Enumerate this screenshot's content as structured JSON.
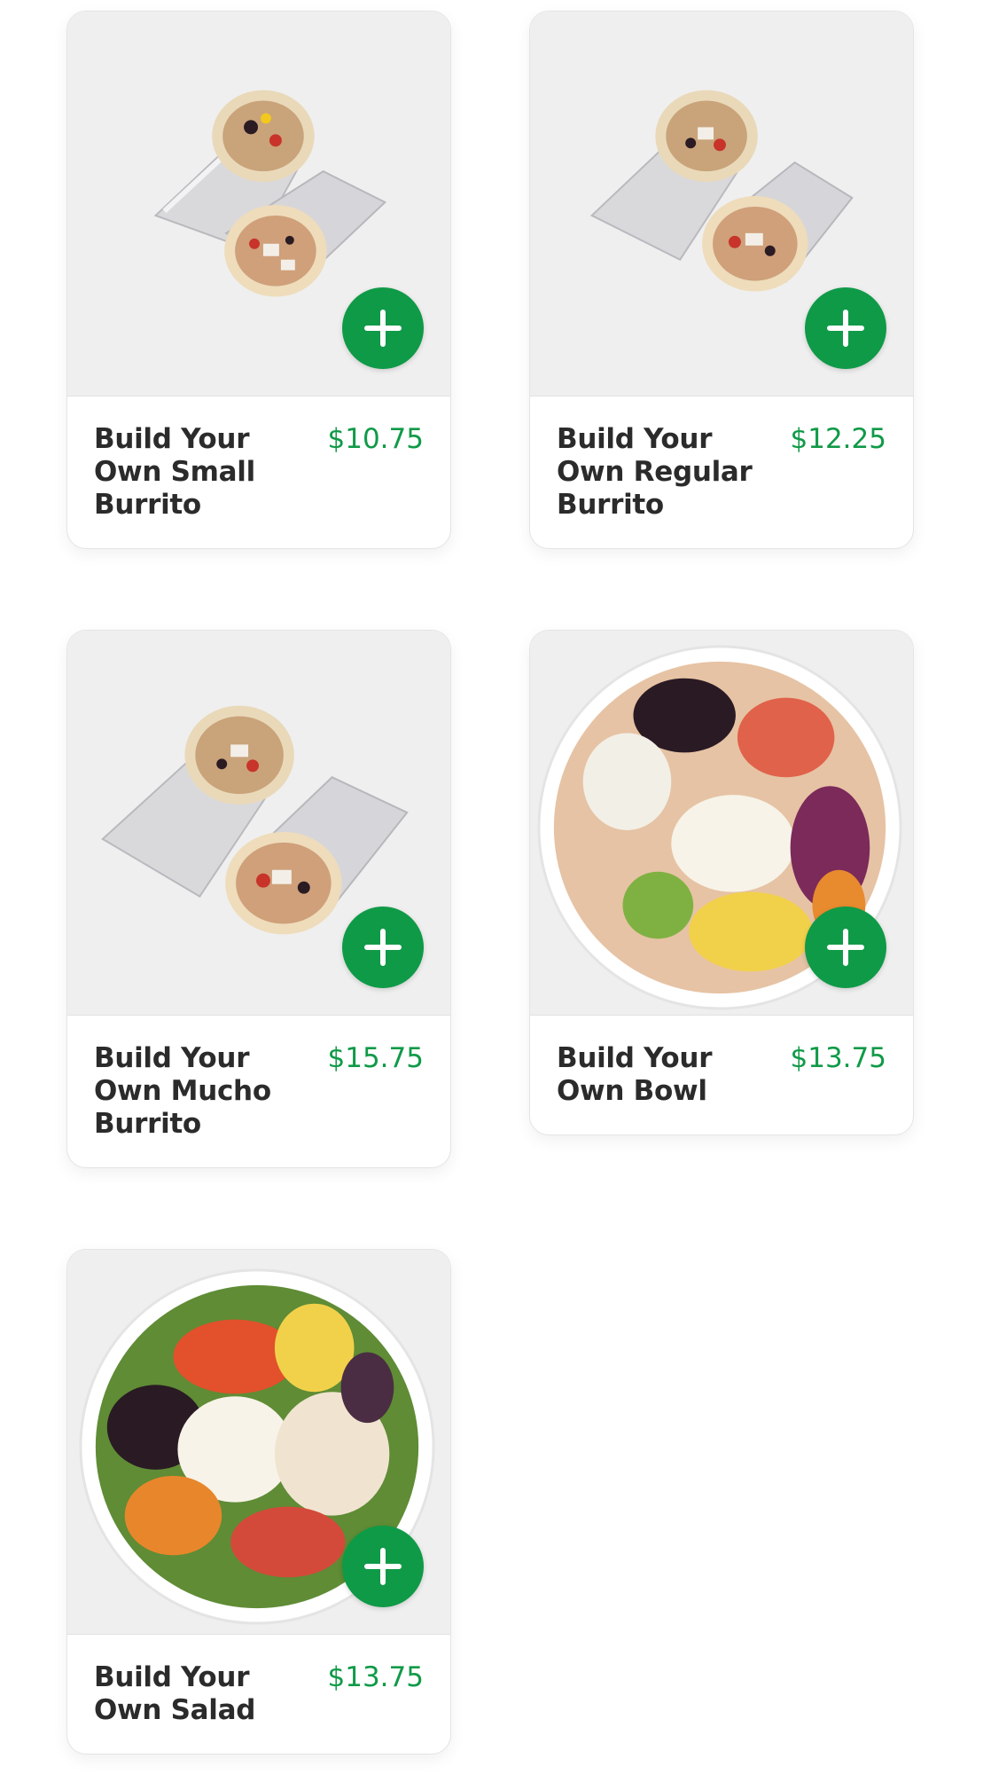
{
  "colors": {
    "accent": "#0f9a47",
    "price": "#109a48",
    "card_image_bg": "#efefef",
    "text": "#2b2b2b"
  },
  "menu_items": [
    {
      "name": "Build Your Own Small Burrito",
      "price": "$10.75",
      "image": "burrito-icon",
      "add_icon": "plus-icon"
    },
    {
      "name": "Build Your Own Regular Burrito",
      "price": "$12.25",
      "image": "burrito-icon",
      "add_icon": "plus-icon"
    },
    {
      "name": "Build Your Own Mucho Burrito",
      "price": "$15.75",
      "image": "burrito-icon",
      "add_icon": "plus-icon"
    },
    {
      "name": "Build Your Own Bowl",
      "price": "$13.75",
      "image": "bowl-icon",
      "add_icon": "plus-icon"
    },
    {
      "name": "Build Your Own Salad",
      "price": "$13.75",
      "image": "salad-icon",
      "add_icon": "plus-icon"
    }
  ]
}
